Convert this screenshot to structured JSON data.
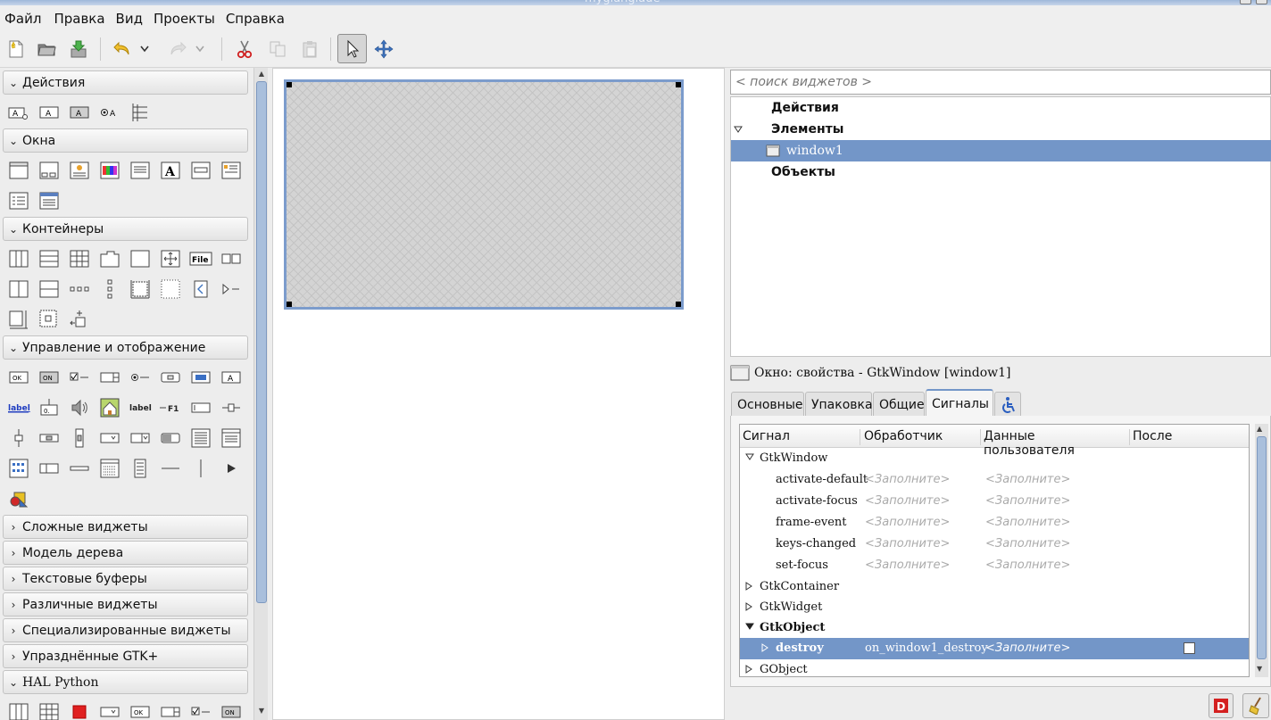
{
  "window": {
    "title": "myglanglade"
  },
  "menu": [
    {
      "label": "Файл"
    },
    {
      "label": "Правка"
    },
    {
      "label": "Вид"
    },
    {
      "label": "Проекты"
    },
    {
      "label": "Справка"
    }
  ],
  "palette": {
    "groups": [
      {
        "label": "Действия",
        "expanded": true
      },
      {
        "label": "Окна",
        "expanded": true
      },
      {
        "label": "Контейнеры",
        "expanded": true
      },
      {
        "label": "Управление и отображение",
        "expanded": true
      },
      {
        "label": "Сложные виджеты",
        "expanded": false
      },
      {
        "label": "Модель дерева",
        "expanded": false
      },
      {
        "label": "Текстовые буферы",
        "expanded": false
      },
      {
        "label": "Различные виджеты",
        "expanded": false
      },
      {
        "label": "Специализированные виджеты",
        "expanded": false
      },
      {
        "label": "Упразднённые GTK+",
        "expanded": false
      },
      {
        "label": "HAL Python",
        "expanded": true
      }
    ],
    "icon_labels": {
      "ok": "OK",
      "on": "ON",
      "label": "label",
      "file": "File",
      "f1": "F1"
    }
  },
  "inspector": {
    "search_placeholder": "< поиск виджетов >",
    "tree": [
      {
        "label": "Действия"
      },
      {
        "label": "Элементы"
      },
      {
        "label": "window1"
      },
      {
        "label": "Объекты"
      }
    ]
  },
  "properties": {
    "title": "Окно: свойства - GtkWindow [window1]",
    "tabs": [
      {
        "label": "Основные",
        "active": false
      },
      {
        "label": "Упаковка",
        "active": false
      },
      {
        "label": "Общие",
        "active": false
      },
      {
        "label": "Сигналы",
        "active": true
      }
    ],
    "columns": [
      "Сигнал",
      "Обработчик",
      "Данные пользователя",
      "После"
    ],
    "placeholder": "<Заполните>",
    "rows": [
      {
        "name": "GtkWindow"
      },
      {
        "name": "activate-default",
        "handler": "<Заполните>",
        "user_data": "<Заполните>"
      },
      {
        "name": "activate-focus",
        "handler": "<Заполните>",
        "user_data": "<Заполните>"
      },
      {
        "name": "frame-event",
        "handler": "<Заполните>",
        "user_data": "<Заполните>"
      },
      {
        "name": "keys-changed",
        "handler": "<Заполните>",
        "user_data": "<Заполните>"
      },
      {
        "name": "set-focus",
        "handler": "<Заполните>",
        "user_data": "<Заполните>"
      },
      {
        "name": "GtkContainer"
      },
      {
        "name": "GtkWidget"
      },
      {
        "name": "GtkObject"
      },
      {
        "name": "destroy",
        "handler": "on_window1_destroy",
        "user_data": "<Заполните>",
        "after": false
      },
      {
        "name": "GObject"
      }
    ]
  },
  "colors": {
    "selection": "#7396c8",
    "accent_border": "#7c9ccc"
  }
}
